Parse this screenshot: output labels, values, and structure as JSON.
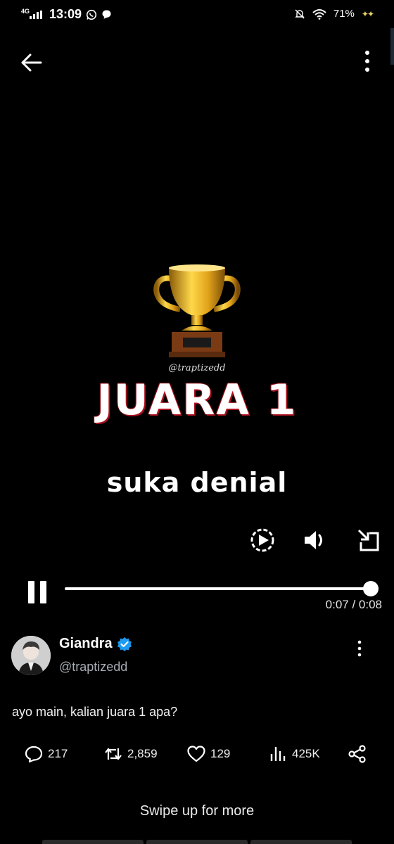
{
  "status_bar": {
    "network": "4G",
    "time": "13:09",
    "battery": "71%",
    "icons": [
      "signal-icon",
      "whatsapp-icon",
      "chat-bubble-icon",
      "mute-icon",
      "wifi-icon",
      "sparkle-icon"
    ]
  },
  "video": {
    "watermark": "@traptizedd",
    "headline": "JUARA 1",
    "caption": "suka denial",
    "elapsed": "0:07",
    "duration": "0:08",
    "time_display": "0:07 / 0:08",
    "progress_fraction": 0.98,
    "controls": [
      "replay-icon",
      "volume-icon",
      "popout-icon",
      "pause-icon"
    ]
  },
  "post": {
    "author_name": "Giandra",
    "verified": true,
    "author_handle": "@traptizedd",
    "text": "ayo main, kalian juara 1 apa?",
    "replies": "217",
    "reposts": "2,859",
    "likes": "129",
    "views": "425K"
  },
  "footer": {
    "swipe_hint": "Swipe up for more"
  },
  "colors": {
    "background": "#000000",
    "verified_badge": "#1d9bf0",
    "headline_outline": "#d0202a",
    "secondary_text": "#a7adb3"
  }
}
